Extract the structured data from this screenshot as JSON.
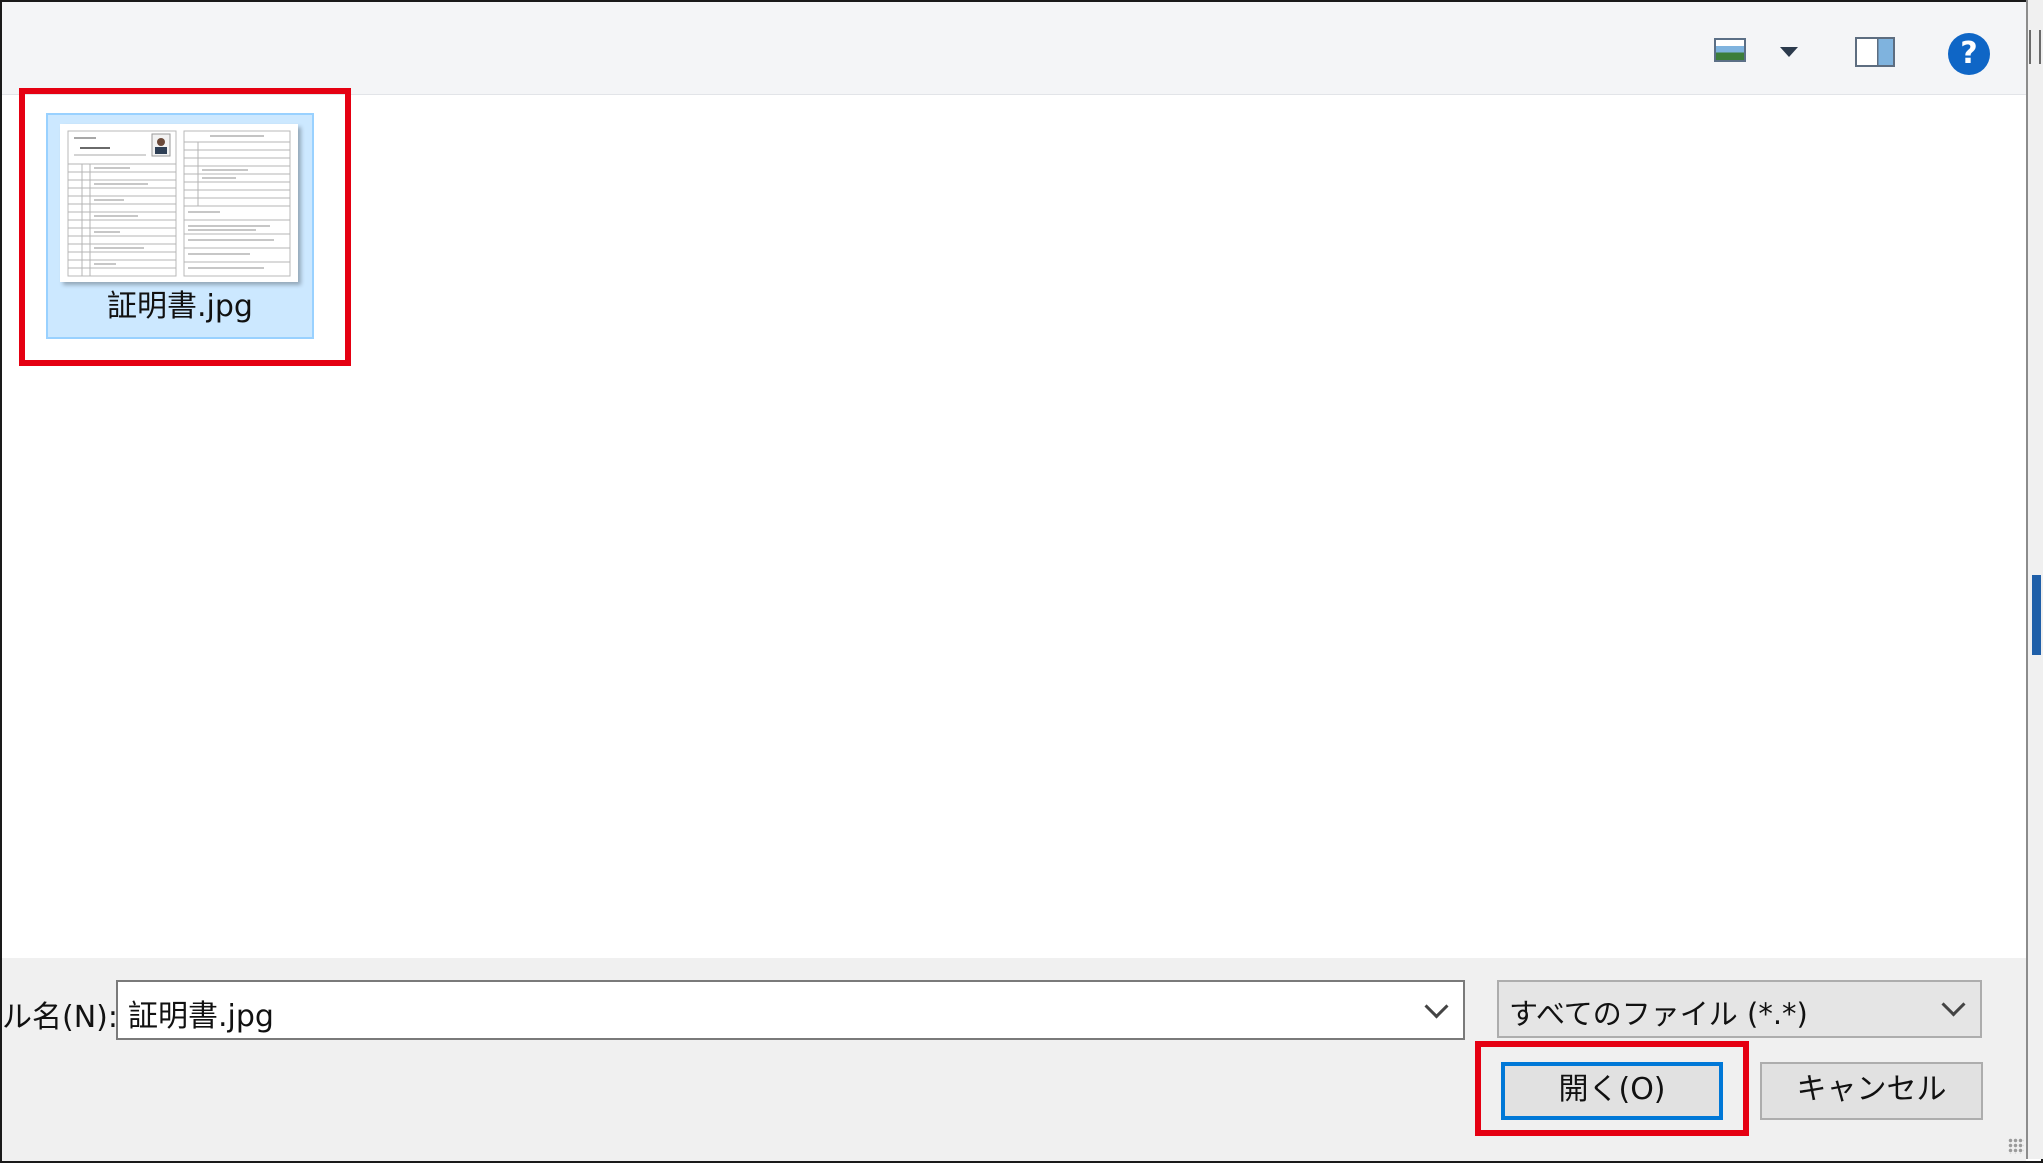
{
  "toolbar": {
    "view_menu_icon": "image-view-icon",
    "view_menu_caret_icon": "caret-down-icon",
    "preview_pane_icon": "preview-pane-icon",
    "help_icon": "help-icon",
    "help_glyph": "?"
  },
  "files": [
    {
      "name": "証明書.jpg",
      "thumbnail_icon": "document-thumbnail-icon",
      "selected": true
    }
  ],
  "bottom_bar": {
    "filename_label": "ル名(N):",
    "filename_value": "証明書.jpg",
    "filetype_value": "すべてのファイル (*.*)",
    "open_button": "開く(O)",
    "cancel_button": "キャンセル"
  },
  "colors": {
    "annotation": "#e50012",
    "selection_fill": "#cce8ff",
    "selection_border": "#99d1ff",
    "default_button_border": "#0078d7",
    "help_blue": "#0f66c6"
  }
}
